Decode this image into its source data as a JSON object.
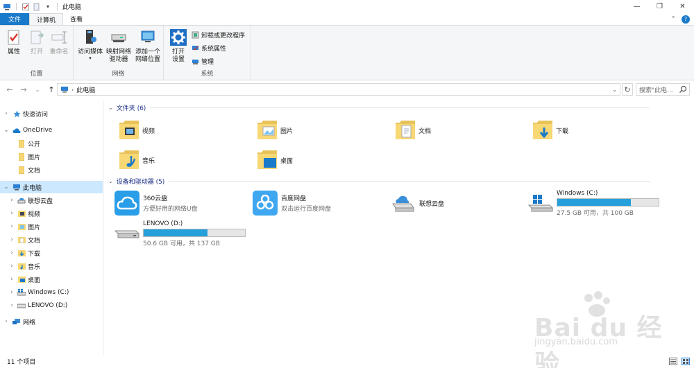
{
  "window": {
    "title": "此电脑",
    "controls": [
      "minimize",
      "maximize",
      "close"
    ]
  },
  "ribbon_tabs": {
    "file": "文件",
    "computer": "计算机",
    "view": "查看"
  },
  "ribbon": {
    "location_group": {
      "label": "位置",
      "properties": "属性",
      "open": "打开",
      "rename": "重命名"
    },
    "network_group": {
      "label": "网络",
      "access_media": "访问媒体",
      "map_drive_line1": "映射网络",
      "map_drive_line2": "驱动器",
      "add_location_line1": "添加一个",
      "add_location_line2": "网络位置"
    },
    "system_group": {
      "label": "系统",
      "open_settings_line1": "打开",
      "open_settings_line2": "设置",
      "uninstall": "卸载或更改程序",
      "system_properties": "系统属性",
      "manage": "管理"
    }
  },
  "address_bar": {
    "path": "此电脑",
    "search_placeholder": "搜索\"此电..."
  },
  "sidebar": {
    "quick_access": "快速访问",
    "onedrive": "OneDrive",
    "onedrive_items": [
      "公开",
      "图片",
      "文档"
    ],
    "this_pc": "此电脑",
    "this_pc_items": [
      "联想云盘",
      "视频",
      "图片",
      "文档",
      "下载",
      "音乐",
      "桌面",
      "Windows (C:)",
      "LENOVO (D:)"
    ],
    "network": "网络"
  },
  "content": {
    "folders_header": "文件夹 (6)",
    "folders": [
      "视频",
      "图片",
      "文档",
      "下载",
      "音乐",
      "桌面"
    ],
    "devices_header": "设备和驱动器 (5)",
    "devices": [
      {
        "name": "360云盘",
        "sub": "方便好用的网络U盘"
      },
      {
        "name": "百度网盘",
        "sub": "双击运行百度网盘"
      },
      {
        "name": "联想云盘",
        "sub": ""
      },
      {
        "name": "Windows (C:)",
        "sub": "27.5 GB 可用，共 100 GB",
        "used_fraction": 0.725
      },
      {
        "name": "LENOVO (D:)",
        "sub": "50.6 GB 可用，共 137 GB",
        "used_fraction": 0.63
      }
    ]
  },
  "status_bar": {
    "count": "11 个项目"
  },
  "watermark": {
    "line1": "Bai du 经验",
    "line2": "jingyan.baidu.com"
  },
  "colors": {
    "accent": "#1979ca",
    "selection": "#cce8ff",
    "header": "#1e3287",
    "progress": "#26a0da",
    "folder": "#f8d775"
  }
}
